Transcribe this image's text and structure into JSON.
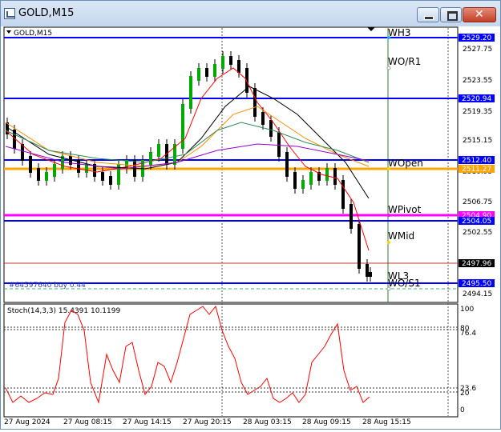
{
  "window": {
    "title": "GOLD,M15",
    "buttons": [
      "minimize",
      "maximize",
      "close"
    ]
  },
  "chart": {
    "label": "GOLD,M15",
    "symbol": "GOLD",
    "timeframe": "M15",
    "order_line_text": "#64597640 buy 0.44",
    "stoch_label": "Stoch(14,3,3) 15.4391 10.1199",
    "level_labels": [
      "WH3",
      "WO/R1",
      "WOpen",
      "WPivot",
      "WMid",
      "WL3",
      "WO/S1"
    ],
    "price_axis": [
      "2527.75",
      "2523.55",
      "2519.35",
      "2515.15",
      "2510.95",
      "2506.75",
      "2502.55",
      "2494.15"
    ],
    "price_tags": {
      "wh3": "2529.20",
      "r1": "2520.94",
      "wopen": "2512.40",
      "orange": "2511.27",
      "wpivot": "2504.90",
      "wpivot2": "2504.05",
      "bid": "2497.96",
      "s1": "2495.50"
    },
    "stoch_axis": [
      "100",
      "80",
      "76.4",
      "23.6",
      "20",
      "0"
    ],
    "time_axis": [
      "27 Aug 2024",
      "27 Aug 08:15",
      "27 Aug 14:15",
      "27 Aug 20:15",
      "28 Aug 03:15",
      "28 Aug 09:15",
      "28 Aug 15:15"
    ],
    "colors": {
      "level_blue": "#0000ff",
      "open_orange": "#ffa500",
      "pivot_magenta": "#ff00ff",
      "ma_red": "#ff0000",
      "ma_black": "#000000",
      "ma_orange": "#ff8c00",
      "ma_green": "#2e8b57",
      "ma_purple": "#9400d3",
      "candle_up": "#00aa00",
      "candle_down": "#000000"
    }
  }
}
